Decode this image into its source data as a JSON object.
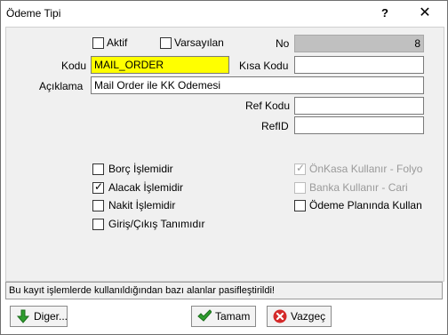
{
  "window": {
    "title": "Ödeme Tipi",
    "help_glyph": "?",
    "close_glyph": "✕"
  },
  "flags": {
    "aktif": {
      "label": "Aktif",
      "checked": false
    },
    "varsayilan": {
      "label": "Varsayılan",
      "checked": false
    }
  },
  "fields": {
    "no": {
      "label": "No",
      "value": "8"
    },
    "kodu": {
      "label": "Kodu",
      "value": "MAIL_ORDER"
    },
    "kisa_kodu": {
      "label": "Kısa Kodu",
      "value": ""
    },
    "aciklama": {
      "label": "Açıklama",
      "value": "Mail Order ile KK Odemesi"
    },
    "ref_kodu": {
      "label": "Ref Kodu",
      "value": ""
    },
    "ref_id": {
      "label": "RefID",
      "value": ""
    }
  },
  "options_left": [
    {
      "label": "Borç İşlemidir",
      "checked": false
    },
    {
      "label": "Alacak İşlemidir",
      "checked": true
    },
    {
      "label": "Nakit İşlemidir",
      "checked": false
    },
    {
      "label": "Giriş/Çıkış Tanımıdır",
      "checked": false
    }
  ],
  "options_right": [
    {
      "label": "ÖnKasa Kullanır - Folyo",
      "checked": true,
      "disabled": true
    },
    {
      "label": "Banka Kullanır - Cari",
      "checked": false,
      "disabled": true
    },
    {
      "label": "Ödeme Planında Kullan",
      "checked": false,
      "disabled": false
    }
  ],
  "status_message": "Bu kayıt işlemlerde kullanıldığından bazı alanlar pasifleştirildi!",
  "buttons": {
    "diger": "Diger...",
    "tamam": "Tamam",
    "vazgec": "Vazgeç"
  },
  "colors": {
    "kodu_background": "#ffff00",
    "no_background": "#c0c0c0",
    "ok_icon": "#2e9e2e",
    "cancel_icon": "#d42a2a",
    "diger_icon": "#2e9e2e"
  }
}
